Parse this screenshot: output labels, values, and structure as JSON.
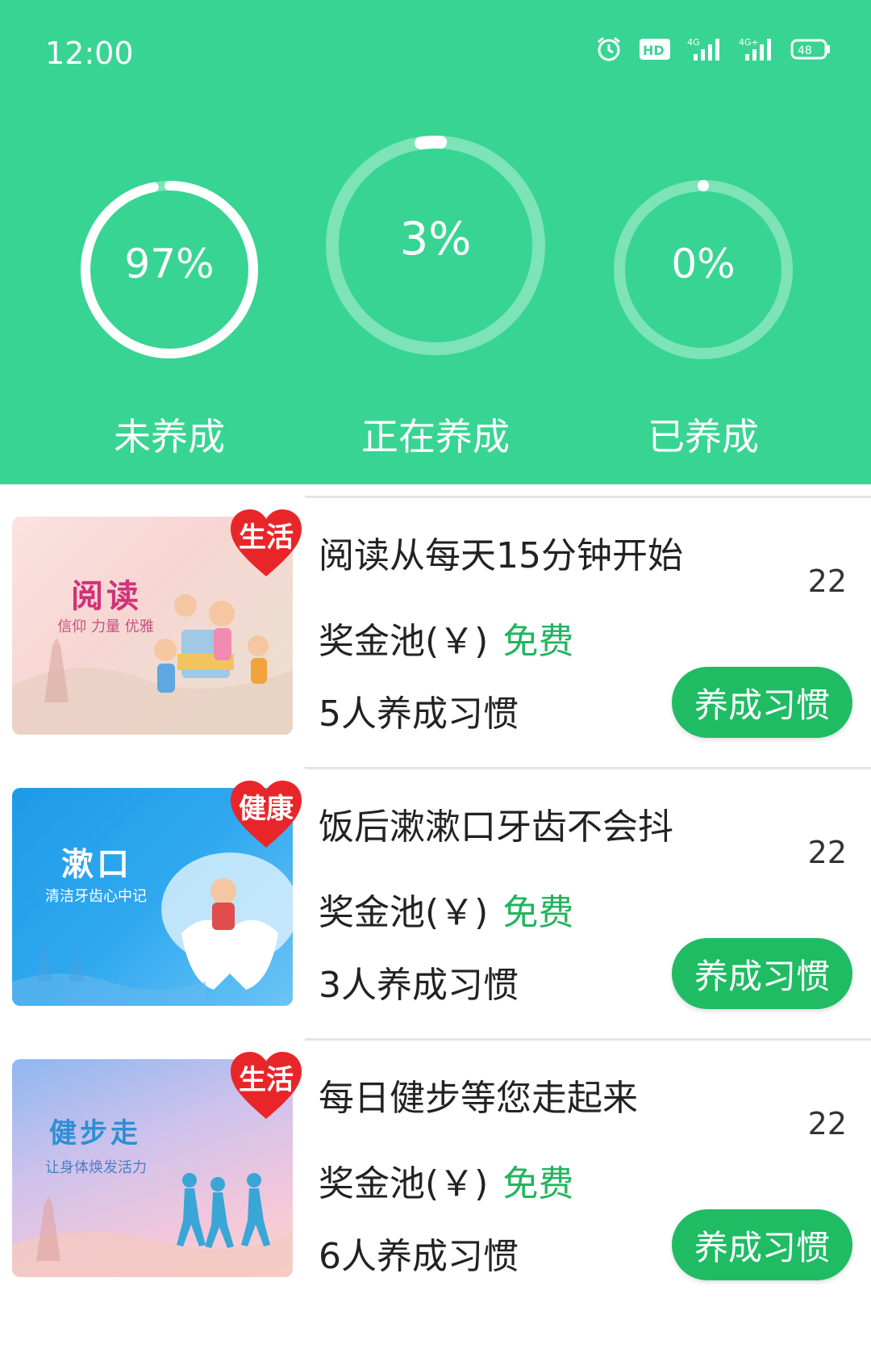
{
  "status_bar": {
    "time": "12:00",
    "battery": "48",
    "hd_label": "HD",
    "network": [
      "4G",
      "4G+"
    ]
  },
  "colors": {
    "header": "#38d493",
    "accent_green": "#1fbc64",
    "free_text": "#22b45e",
    "heart_red": "#e8262a"
  },
  "stats": [
    {
      "percent": "97%",
      "value": 0.97,
      "label": "未养成"
    },
    {
      "percent": "3%",
      "value": 0.03,
      "label": "正在养成"
    },
    {
      "percent": "0%",
      "value": 0.0,
      "label": "已养成"
    }
  ],
  "habits": [
    {
      "category": "生活",
      "title": "阅读从每天15分钟开始",
      "count": "22",
      "pool_label": "奖金池(￥)",
      "pool_value": "免费",
      "people": "5人养成习惯",
      "button": "养成习惯",
      "image_title": "阅读",
      "image_subtitle": "信仰 力量 优雅"
    },
    {
      "category": "健康",
      "title": "饭后漱漱口牙齿不会抖",
      "count": "22",
      "pool_label": "奖金池(￥)",
      "pool_value": "免费",
      "people": "3人养成习惯",
      "button": "养成习惯",
      "image_title": "漱口",
      "image_subtitle": "清洁牙齿心中记"
    },
    {
      "category": "生活",
      "title": "每日健步等您走起来",
      "count": "22",
      "pool_label": "奖金池(￥)",
      "pool_value": "免费",
      "people": "6人养成习惯",
      "button": "养成习惯",
      "image_title": "健步走",
      "image_subtitle": "让身体焕发活力"
    }
  ]
}
